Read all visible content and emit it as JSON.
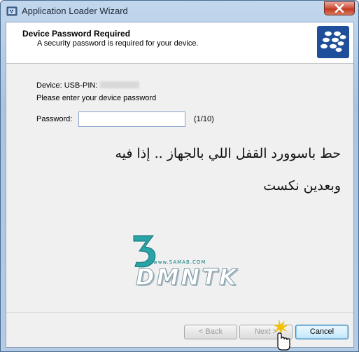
{
  "window": {
    "title": "Application Loader Wizard",
    "close_icon": "close-icon"
  },
  "header": {
    "title": "Device Password Required",
    "subtitle": "A security password is required for your device.",
    "logo_icon": "blackberry-logo-icon"
  },
  "body": {
    "device_label": "Device: USB-PIN:",
    "device_pin_hidden": true,
    "instruction": "Please enter your device password",
    "password_label": "Password:",
    "password_value": "",
    "attempts": "(1/10)"
  },
  "annotation": {
    "line1": "حط باسوورد القفل اللي بالجهاز .. إذا فيه",
    "line2": "وبعدين نكست"
  },
  "watermark": {
    "site": "www.SAMAB.COM",
    "name": "DMNTK",
    "number": "3"
  },
  "footer": {
    "back_label": "< Back",
    "next_label": "Next >",
    "cancel_label": "Cancel",
    "back_enabled": false,
    "next_enabled": false
  },
  "colors": {
    "title_bar": "#b4cbe6",
    "close_button": "#c33a22",
    "logo_bg": "#1f4f9a",
    "watermark_accent": "#0e7d80"
  }
}
